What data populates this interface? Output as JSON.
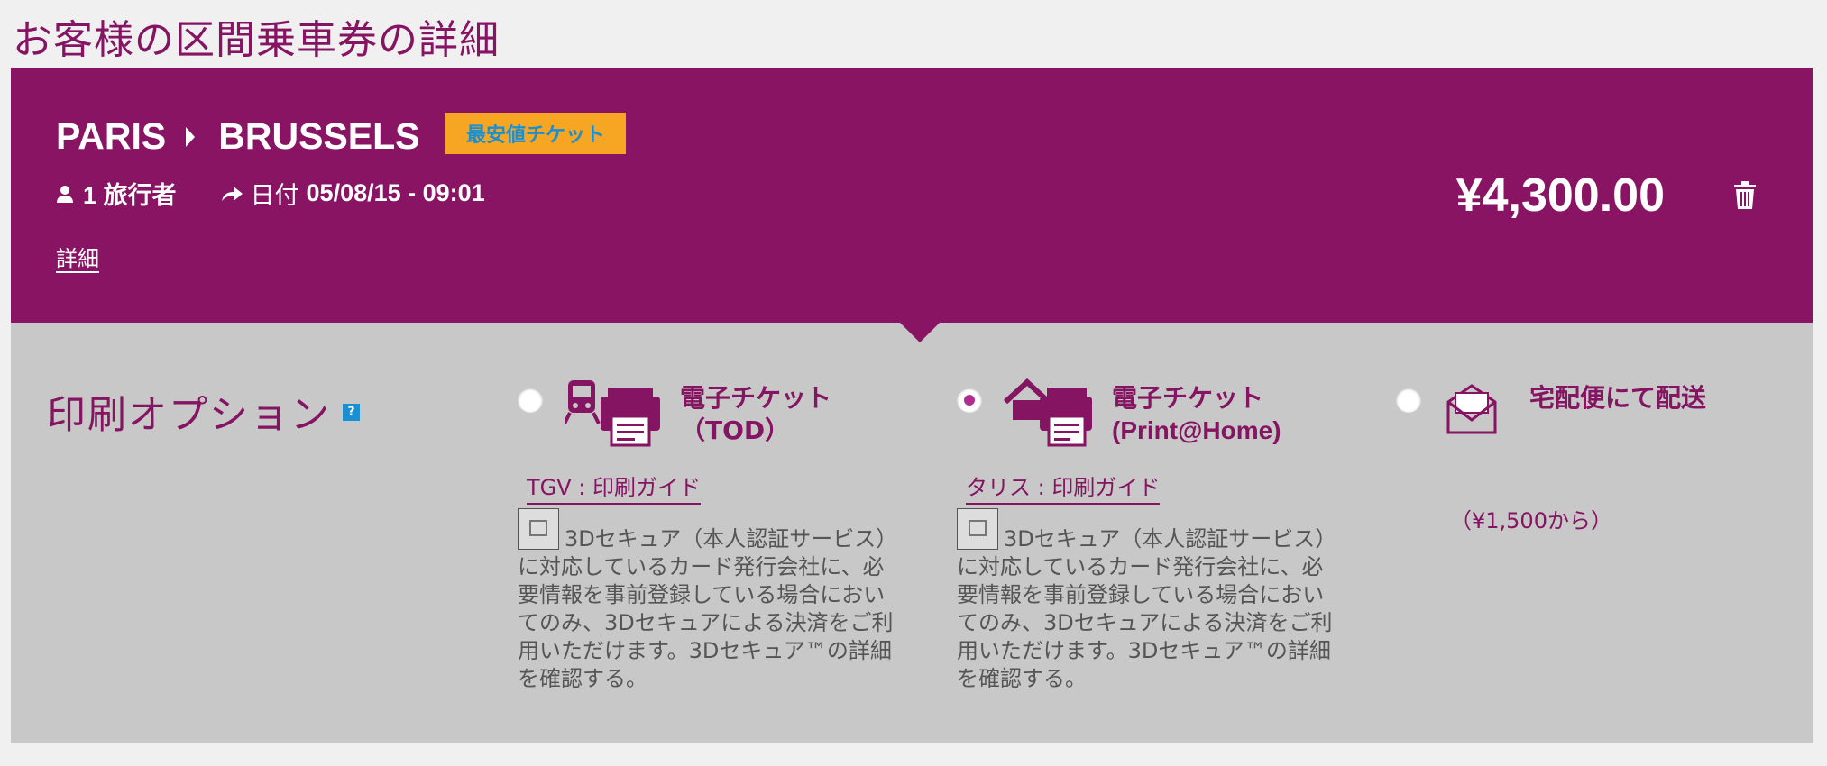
{
  "page": {
    "title": "お客様の区間乗車券の詳細"
  },
  "trip": {
    "origin": "PARIS",
    "destination": "BRUSSELS",
    "badge": "最安値チケット",
    "travellers": "1 旅行者",
    "date_label": "日付",
    "date_value": "05/08/15 - 09:01",
    "details_link": "詳細",
    "price": "¥4,300.00"
  },
  "print_options": {
    "title": "印刷オプション",
    "help": "?",
    "options": [
      {
        "label_line1": "電子チケット",
        "label_line2": "（TOD）",
        "guide_link": "TGV : 印刷ガイド",
        "note": "3Dセキュア（本人認証サービス）に対応しているカード発行会社に、必要情報を事前登録している場合においてのみ、3Dセキュアによる決済をご利用いただけます。3Dセキュア™の詳細を確認する。",
        "selected": false,
        "icon": "train-printer-icon"
      },
      {
        "label_line1": "電子チケット",
        "label_line2": "(Print@Home)",
        "guide_link": "タリス : 印刷ガイド",
        "note": "3Dセキュア（本人認証サービス）に対応しているカード発行会社に、必要情報を事前登録している場合においてのみ、3Dセキュアによる決済をご利用いただけます。3Dセキュア™の詳細を確認する。",
        "selected": true,
        "icon": "home-printer-icon"
      },
      {
        "label_line1": "宅配便にて配送",
        "price_note": "（¥1,500から）",
        "selected": false,
        "icon": "envelope-icon"
      }
    ]
  },
  "colors": {
    "brand": "#8a1464",
    "badge_bg": "#f6a623",
    "badge_text": "#1a8fd1",
    "panel_bg": "#c8c8c8"
  }
}
